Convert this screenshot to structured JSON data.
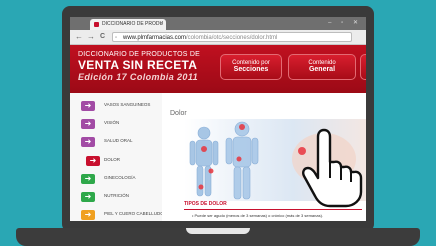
{
  "browser": {
    "tab_title": "DICCIONARIO DE PRODU",
    "tab_close": "×",
    "window_controls": "– ▫ ✕",
    "url_host": "www.plmfarmacias.com",
    "url_path": "/colombia/otc/secciones/dolor.html",
    "back": "←",
    "forward": "→",
    "reload": "C"
  },
  "header": {
    "line1": "DICCIONARIO DE PRODUCTOS DE",
    "line2": "VENTA SIN RECETA",
    "line3": "Edición 17 Colombia 2011",
    "buttons": [
      {
        "small": "Contenido por",
        "large": "Secciones"
      },
      {
        "small": "Contenido",
        "large": "General"
      }
    ]
  },
  "menu": {
    "items": [
      {
        "label": "VASOS SANGUINEOS",
        "color": "#a24ba5"
      },
      {
        "label": "VISIÓN",
        "color": "#a24ba5"
      },
      {
        "label": "SALUD ORAL",
        "color": "#a24ba5"
      },
      {
        "label": "DOLOR",
        "color": "#c8102e"
      },
      {
        "label": "GINECOLOGÍA",
        "color": "#2ea84a"
      },
      {
        "label": "NUTRICIÓN",
        "color": "#2ea84a"
      },
      {
        "label": "PIEL Y CUERO CABELLUDO",
        "color": "#f0a020"
      }
    ]
  },
  "content": {
    "title": "Dolor",
    "section_title": "TIPOS DE DOLOR",
    "section_text": "• Puede ser agudo (menos de 3 semanas) o crónico (más de 3 semanas)."
  }
}
